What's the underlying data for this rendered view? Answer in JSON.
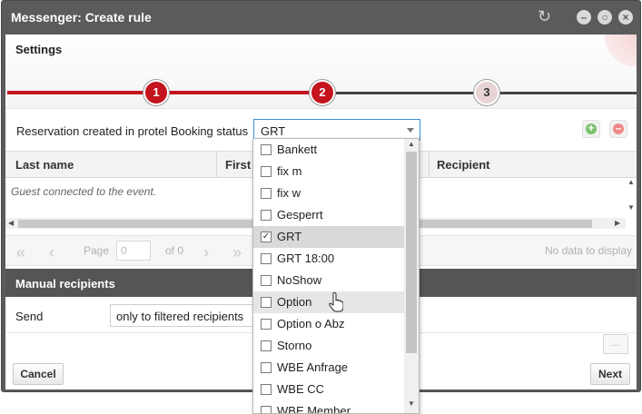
{
  "window": {
    "title": "Messenger: Create rule"
  },
  "wizard": {
    "title": "Settings",
    "steps": [
      {
        "label": "1",
        "state": "done"
      },
      {
        "label": "2",
        "state": "active"
      },
      {
        "label": "3",
        "state": "inactive"
      }
    ]
  },
  "filter": {
    "label": "Reservation created in protel Booking status",
    "value": "GRT"
  },
  "grid": {
    "columns": [
      "Last name",
      "First",
      "Recipient"
    ],
    "empty_text": "Guest connected to the event."
  },
  "pager": {
    "page_label": "Page",
    "page_value": "0",
    "of_label": "of 0",
    "no_data": "No data to display"
  },
  "manual": {
    "header": "Manual recipients",
    "send_label": "Send",
    "send_value": "only to filtered recipients",
    "more_button": "..."
  },
  "buttons": {
    "cancel": "Cancel",
    "next": "Next"
  },
  "dropdown": {
    "options": [
      {
        "label": "Bankett",
        "checked": false
      },
      {
        "label": "fix m",
        "checked": false
      },
      {
        "label": "fix w",
        "checked": false
      },
      {
        "label": "Gesperrt",
        "checked": false
      },
      {
        "label": "GRT",
        "checked": true
      },
      {
        "label": "GRT 18:00",
        "checked": false
      },
      {
        "label": "NoShow",
        "checked": false
      },
      {
        "label": "Option",
        "checked": false
      },
      {
        "label": "Option o Abz",
        "checked": false
      },
      {
        "label": "Storno",
        "checked": false
      },
      {
        "label": "WBE Anfrage",
        "checked": false
      },
      {
        "label": "WBE CC",
        "checked": false
      },
      {
        "label": "WBE Member",
        "checked": false
      }
    ],
    "hovered": "Option"
  },
  "colors": {
    "accent": "#c4141e",
    "header_bg": "#5b5b5b",
    "focus_border": "#3b8fd6"
  }
}
